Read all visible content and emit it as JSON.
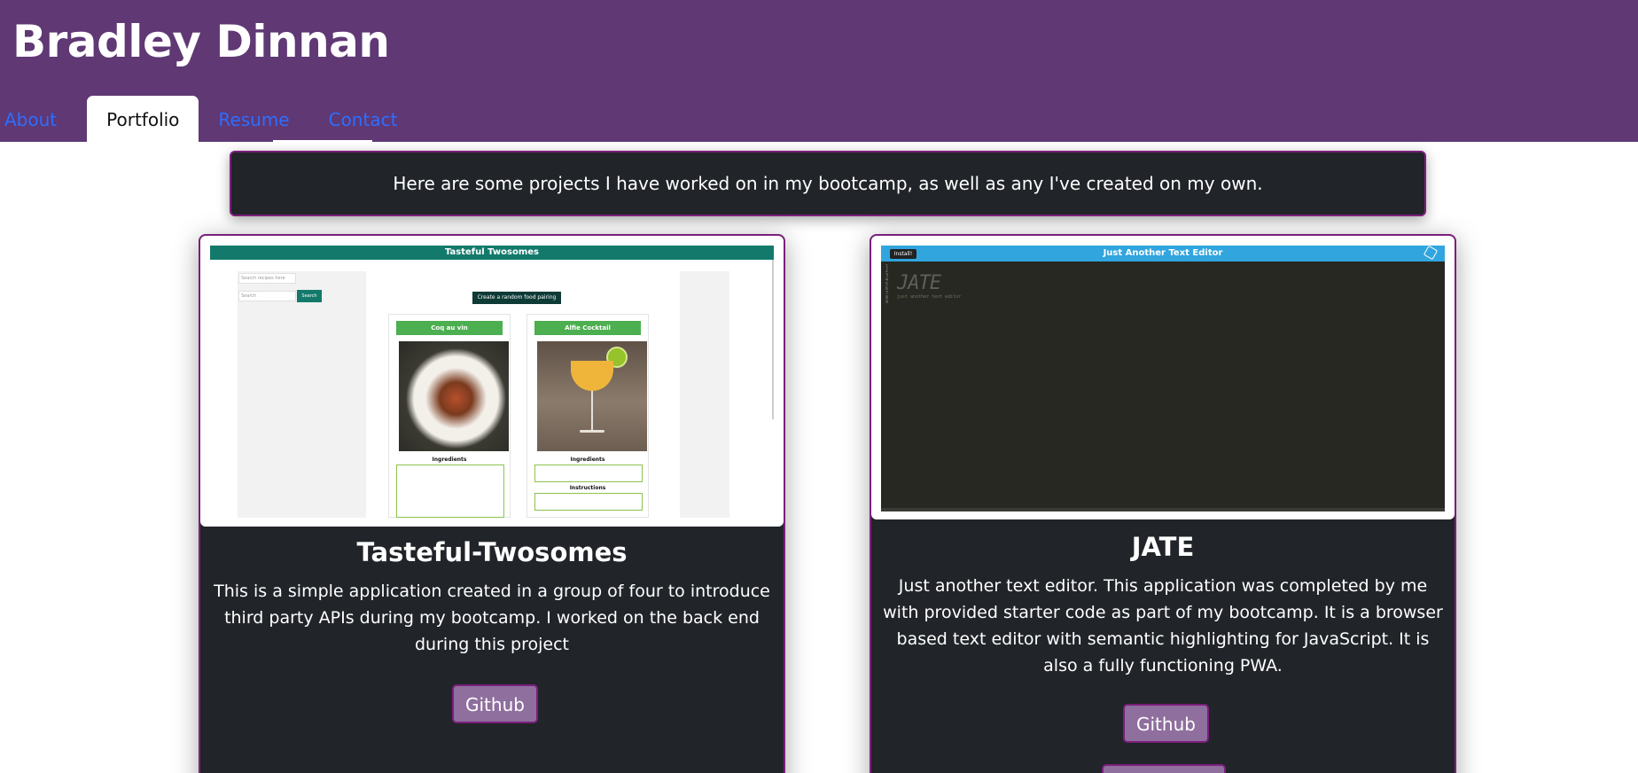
{
  "header": {
    "title": "Bradley Dinnan",
    "background_color": "#5f3874"
  },
  "nav": {
    "tabs": [
      {
        "label": "About",
        "active": false
      },
      {
        "label": "Portfolio",
        "active": true
      },
      {
        "label": "Resume",
        "active": false
      },
      {
        "label": "Contact",
        "active": false
      }
    ],
    "link_color": "#2f6dfd"
  },
  "intro": {
    "text": "Here are some projects I have worked on in my bootcamp, as well as any I've created on my own."
  },
  "projects": [
    {
      "title": "Tasteful-Twosomes",
      "description": "This is a simple application created in a group of four to introduce third party APIs during my bootcamp. I worked on the back end during this project",
      "github_label": "Github",
      "screenshot": {
        "app_title": "Tasteful Twosomes",
        "search_placeholder_1": "Search recipes here",
        "search_placeholder_2": "Search",
        "search_button": "Search",
        "random_button": "Create a random food pairing",
        "dishes": [
          {
            "name": "Coq au vin",
            "section_label": "Ingredients"
          },
          {
            "name": "Alfie Cocktail",
            "section_label": "Ingredients",
            "section_label_2": "Instructions"
          }
        ]
      }
    },
    {
      "title": "JATE",
      "description": "Just another text editor. This application was completed by me with provided starter code as part of my bootcamp. It is a browser based text editor with semantic highlighting for JavaScript. It is also a fully functioning PWA.",
      "github_label": "Github",
      "screenshot": {
        "app_title": "Just Another Text Editor",
        "install_label": "Install!",
        "ascii_logo": "JATE",
        "caption": "just another text editor"
      }
    }
  ],
  "colors": {
    "card_background": "#212429",
    "card_border": "#7b1f7b",
    "button_background": "#8f6f9e"
  }
}
